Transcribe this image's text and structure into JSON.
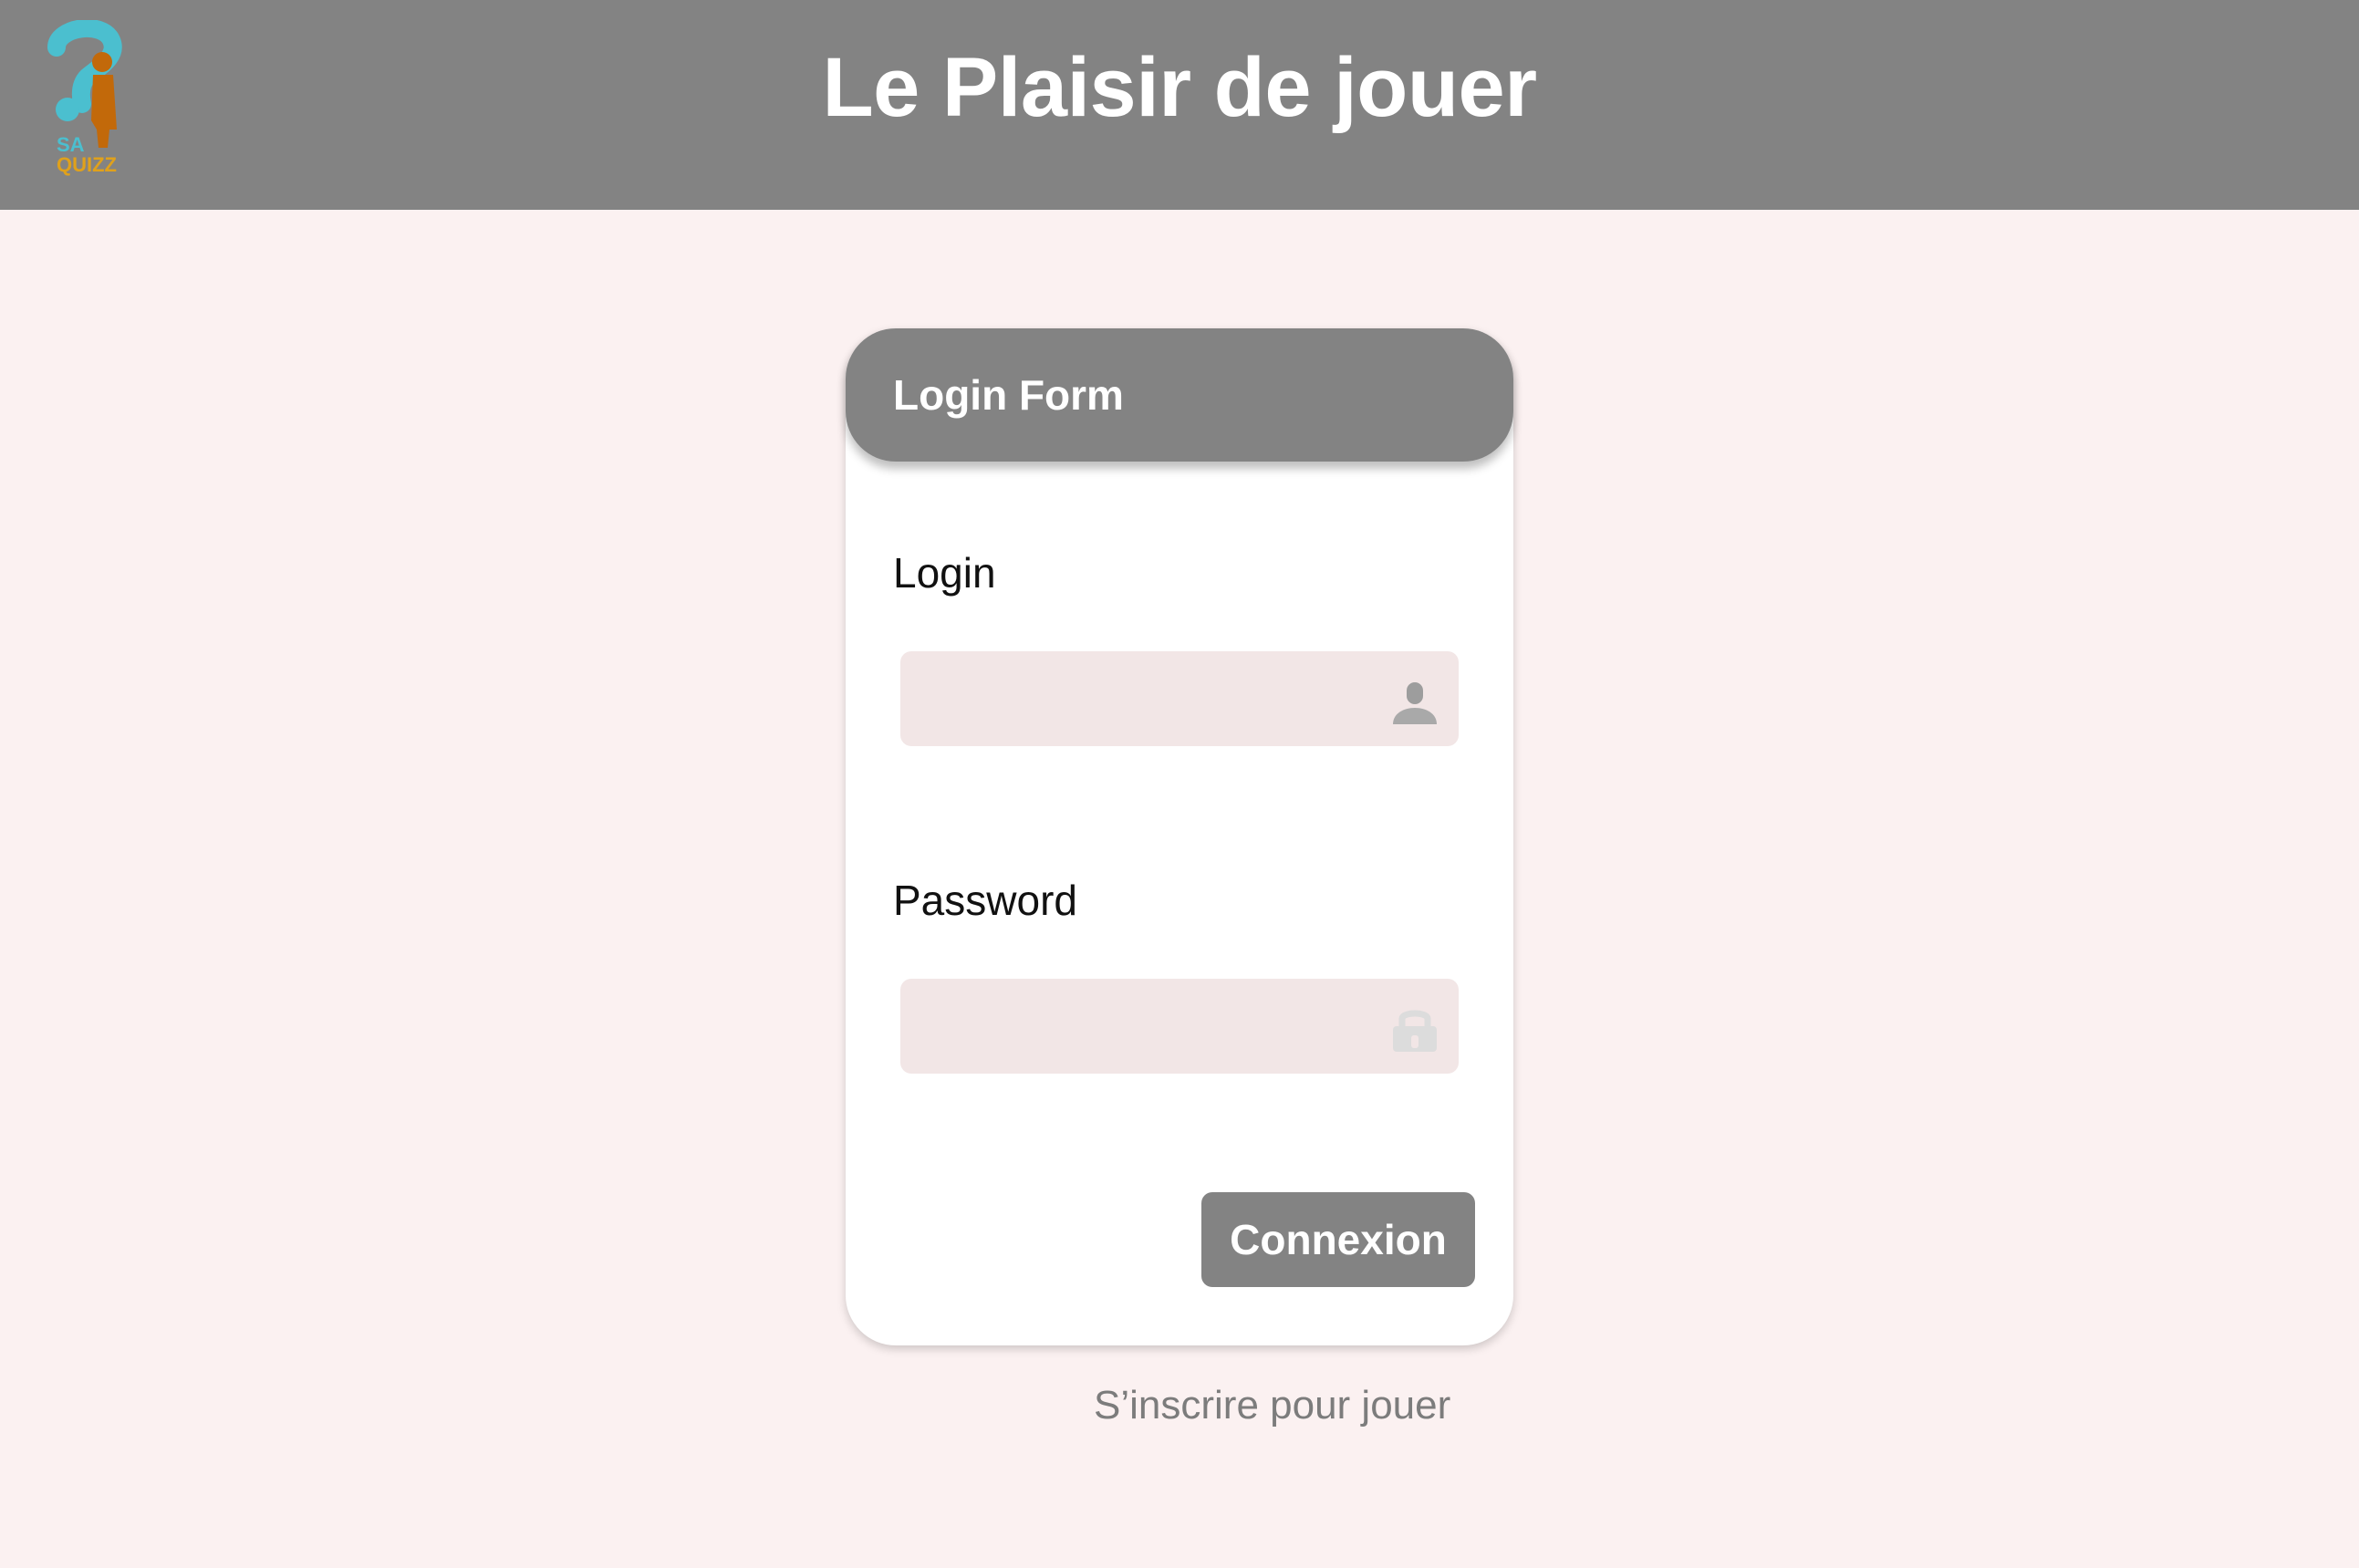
{
  "header": {
    "title": "Le Plaisir de jouer",
    "logo_text_top": "SA",
    "logo_text_bottom": "QUIZZ"
  },
  "login_form": {
    "title": "Login Form",
    "login_label": "Login",
    "login_value": "",
    "login_icon": "user-icon",
    "password_label": "Password",
    "password_value": "",
    "password_icon": "lock-icon",
    "submit_label": "Connexion"
  },
  "signup_link": "S’inscrire pour jouer",
  "colors": {
    "header_bg": "#838383",
    "page_bg": "#fbf1f1",
    "input_bg": "#f2e6e6",
    "logo_teal": "#4bbfcf",
    "logo_orange": "#c2690a",
    "logo_gold": "#e0a11b"
  }
}
